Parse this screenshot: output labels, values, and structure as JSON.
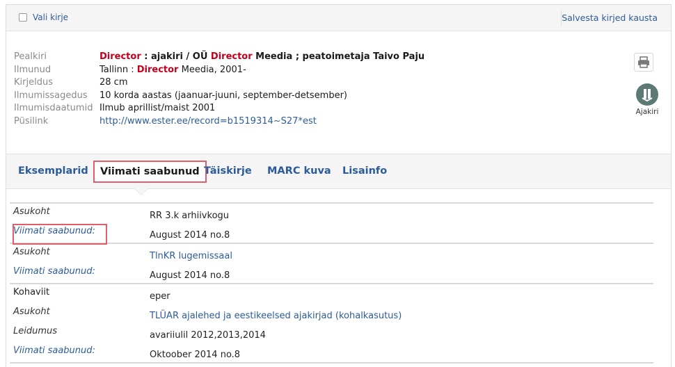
{
  "topbar": {
    "select_label": "Vali kirje",
    "save_label": "Salvesta kirjed kausta"
  },
  "record": {
    "fields": [
      {
        "label": "Pealkiri"
      },
      {
        "label": "Ilmunud"
      },
      {
        "label": "Kirjeldus"
      },
      {
        "label": "Ilmumissagedus"
      },
      {
        "label": "Ilmumisdaatumid"
      },
      {
        "label": "Püsilink"
      }
    ],
    "title_parts": [
      "Director",
      " : ajakiri / OÜ ",
      "Director",
      " Meedia ; peatoimetaja Taivo Paju"
    ],
    "published_parts": [
      "Tallinn : ",
      "Director",
      " Meedia, 2001-"
    ],
    "description": "28 cm",
    "frequency": "10 korda aastas (jaanuar-juuni, september-detsember)",
    "dates": "Ilmub aprillist/maist 2001",
    "permalink": "http://www.ester.ee/record=b1519314~S27*est",
    "highlight_color": "#c3001e"
  },
  "type": {
    "icon": "journal-icon",
    "label": "Ajakiri"
  },
  "tabs": [
    {
      "label": "Eksemplarid"
    },
    {
      "label": "Viimati saabunud"
    },
    {
      "label": "Täiskirje"
    },
    {
      "label": "MARC kuva"
    },
    {
      "label": "Lisainfo"
    }
  ],
  "active_tab": "Viimati saabunud",
  "holdings": [
    {
      "rows": [
        {
          "label": "Asukoht",
          "value": "RR 3.k arhiivkogu"
        },
        {
          "label": "Viimati saabunud:",
          "value": "August 2014 no.8"
        }
      ]
    },
    {
      "rows": [
        {
          "label": "Asukoht",
          "value": "TlnKR lugemissaal"
        },
        {
          "label": "Viimati saabunud:",
          "value": "August 2014 no.8"
        }
      ]
    },
    {
      "rows": [
        {
          "label": "Kohaviit",
          "value": "eper"
        },
        {
          "label": "Asukoht",
          "value": "TLÜAR ajalehed ja eestikeelsed ajakirjad (kohalkasutus)"
        },
        {
          "label": "Leidumus",
          "value": "avariiulil 2012,2013,2014"
        },
        {
          "label": "Viimati saabunud:",
          "value": "Oktoober 2014 no.8"
        }
      ]
    }
  ],
  "colors": {
    "link": "#2c5b99",
    "annotation": "#e05e6a"
  }
}
